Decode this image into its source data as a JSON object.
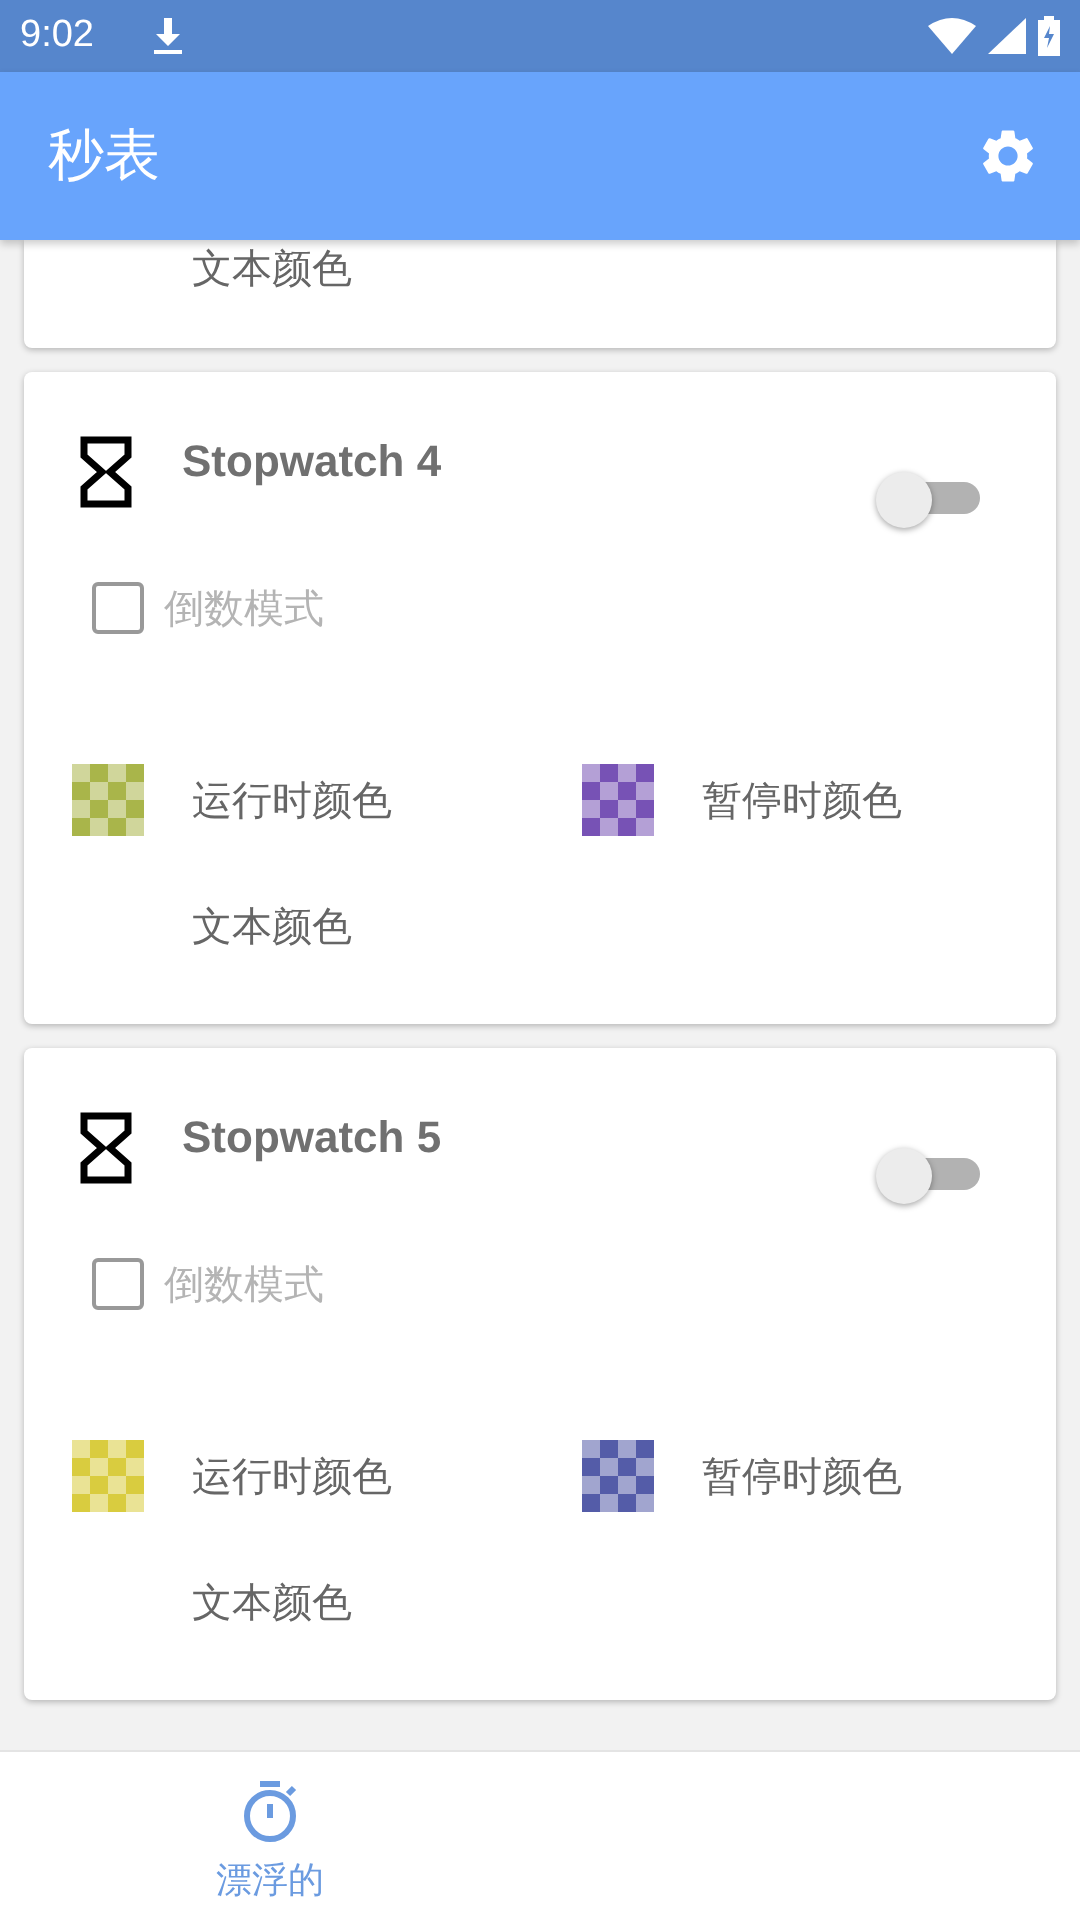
{
  "status_bar": {
    "time": "9:02"
  },
  "app_bar": {
    "title": "秒表"
  },
  "partial_card": {
    "text_color_label": "文本颜色"
  },
  "stopwatches": [
    {
      "name": "Stopwatch 4",
      "enabled": false,
      "countdown": {
        "label": "倒数模式",
        "checked": false,
        "disabled": true
      },
      "running_color": {
        "label": "运行时颜色",
        "color": "#a9b54a"
      },
      "paused_color": {
        "label": "暂停时颜色",
        "color": "#7752b5"
      },
      "text_color": {
        "label": "文本颜色"
      }
    },
    {
      "name": "Stopwatch 5",
      "enabled": false,
      "countdown": {
        "label": "倒数模式",
        "checked": false,
        "disabled": true
      },
      "running_color": {
        "label": "运行时颜色",
        "color": "#d9cc3f"
      },
      "paused_color": {
        "label": "暂停时颜色",
        "color": "#545ca8"
      },
      "text_color": {
        "label": "文本颜色"
      }
    }
  ],
  "bottom_nav": [
    {
      "label": "漂浮的",
      "selected": true
    }
  ]
}
